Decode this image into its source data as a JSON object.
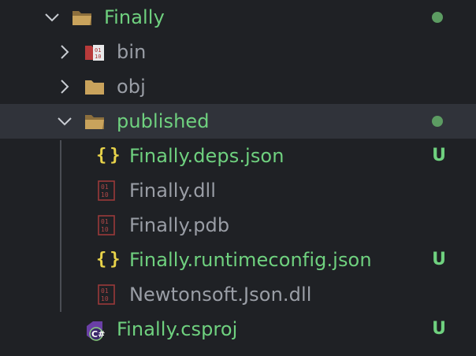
{
  "colors": {
    "added": "#6fd17f",
    "dot": "#5c9c62",
    "muted": "#9a9ea6",
    "folder": "#c9a35c",
    "braces": "#e8d34a"
  },
  "tree": {
    "root": {
      "label": "Finally",
      "icon": "folder-open-icon",
      "expanded": true,
      "status": "modified-dot"
    },
    "bin": {
      "label": "bin",
      "icon": "binary-folder-icon",
      "expanded": false
    },
    "obj": {
      "label": "obj",
      "icon": "folder-icon",
      "expanded": false
    },
    "published": {
      "label": "published",
      "icon": "folder-open-icon",
      "expanded": true,
      "status": "modified-dot",
      "files": [
        {
          "label": "Finally.deps.json",
          "icon": "json-braces-icon",
          "status": "U",
          "braces": "{}"
        },
        {
          "label": "Finally.dll",
          "icon": "binary-file-icon"
        },
        {
          "label": "Finally.pdb",
          "icon": "binary-file-icon"
        },
        {
          "label": "Finally.runtimeconfig.json",
          "icon": "json-braces-icon",
          "status": "U",
          "braces": "{}"
        },
        {
          "label": "Newtonsoft.Json.dll",
          "icon": "binary-file-icon"
        }
      ]
    },
    "csproj": {
      "label": "Finally.csproj",
      "icon": "csharp-project-icon",
      "status": "U"
    }
  }
}
